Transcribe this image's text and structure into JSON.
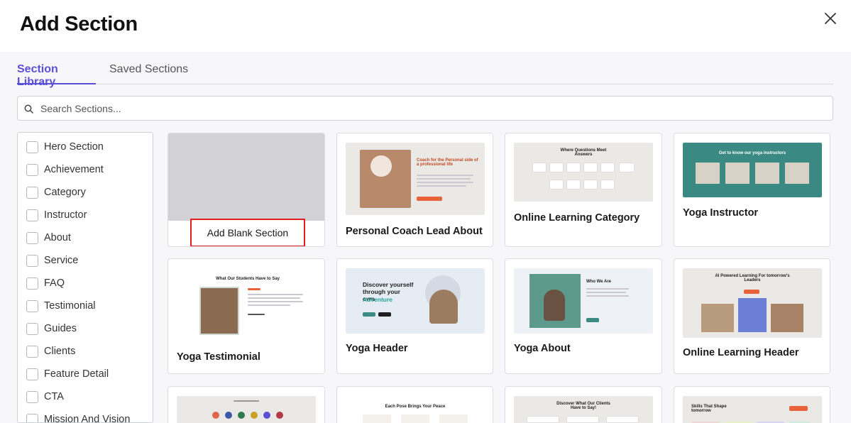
{
  "header": {
    "title": "Add Section",
    "close_icon": "close-icon"
  },
  "tabs": [
    {
      "label": "Section Library",
      "active": true
    },
    {
      "label": "Saved Sections",
      "active": false
    }
  ],
  "search": {
    "placeholder": "Search Sections...",
    "value": "",
    "icon": "search-icon"
  },
  "categories": [
    {
      "label": "Hero Section",
      "checked": false
    },
    {
      "label": "Achievement",
      "checked": false
    },
    {
      "label": "Category",
      "checked": false
    },
    {
      "label": "Instructor",
      "checked": false
    },
    {
      "label": "About",
      "checked": false
    },
    {
      "label": "Service",
      "checked": false
    },
    {
      "label": "FAQ",
      "checked": false
    },
    {
      "label": "Testimonial",
      "checked": false
    },
    {
      "label": "Guides",
      "checked": false
    },
    {
      "label": "Clients",
      "checked": false
    },
    {
      "label": "Feature Detail",
      "checked": false
    },
    {
      "label": "CTA",
      "checked": false
    },
    {
      "label": "Mission And Vision",
      "checked": false
    }
  ],
  "blank_card": {
    "button_label": "Add Blank Section"
  },
  "cards": [
    {
      "title": "Personal Coach Lead About",
      "thumb": {
        "headline": "Coach for the Personal side of a professional life"
      }
    },
    {
      "title": "Online Learning Category",
      "thumb": {
        "headline": "Where Questions Meet Answers"
      }
    },
    {
      "title": "Yoga Instructor",
      "thumb": {
        "headline": "Get to know our yoga instructors"
      }
    },
    {
      "title": "Yoga Testimonial",
      "thumb": {
        "headline": "What Our Students Have to Say"
      }
    },
    {
      "title": "Yoga Header",
      "thumb": {
        "headline": "Discover yourself through your own",
        "highlight": "Adventure"
      }
    },
    {
      "title": "Yoga About",
      "thumb": {
        "headline": "Who We Are"
      }
    },
    {
      "title": "Online Learning Header",
      "thumb": {
        "headline": "AI Powered Learning For tomorrow's Leaders"
      }
    },
    {
      "title": "",
      "thumb": {
        "headline": ""
      }
    },
    {
      "title": "",
      "thumb": {
        "headline": "Each Pose Brings Your Peace"
      }
    },
    {
      "title": "",
      "thumb": {
        "headline": "Discover What Our Clients Have to Say!"
      }
    },
    {
      "title": "",
      "thumb": {
        "headline": "Skills That Shape tomorrow"
      }
    }
  ],
  "colors": {
    "accent": "#5a4fd6",
    "highlight_border": "#e0201f",
    "teal": "#3a8a83",
    "orange": "#e8633a"
  }
}
